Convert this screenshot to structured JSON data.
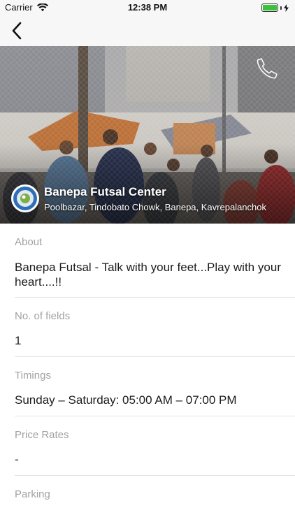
{
  "status_bar": {
    "carrier": "Carrier",
    "time": "12:38 PM",
    "icons": [
      "wifi-icon",
      "battery-icon",
      "charging-bolt-icon"
    ],
    "battery_color": "#3cc13c"
  },
  "nav": {
    "back_icon": "chevron-left-icon"
  },
  "venue": {
    "name": "Banepa Futsal Center",
    "address": "Poolbazar, Tindobato Chowk, Banepa, Kavrepalanchok",
    "call_icon": "phone-icon",
    "logo_icon": "venue-logo-icon"
  },
  "details": {
    "about": {
      "label": "About",
      "value": "Banepa Futsal - Talk with your feet...Play with your heart....!!"
    },
    "fields": {
      "label": "No. of fields",
      "value": "1"
    },
    "timings": {
      "label": "Timings",
      "value": "Sunday – Saturday: 05:00 AM – 07:00 PM"
    },
    "price": {
      "label": "Price Rates",
      "value": "-"
    },
    "parking": {
      "label": "Parking"
    }
  },
  "colors": {
    "label_gray": "#a2a2a2",
    "text_dark": "#1c1c1c",
    "divider": "#e3e3e3",
    "bar_background": "#f7f7f7"
  }
}
